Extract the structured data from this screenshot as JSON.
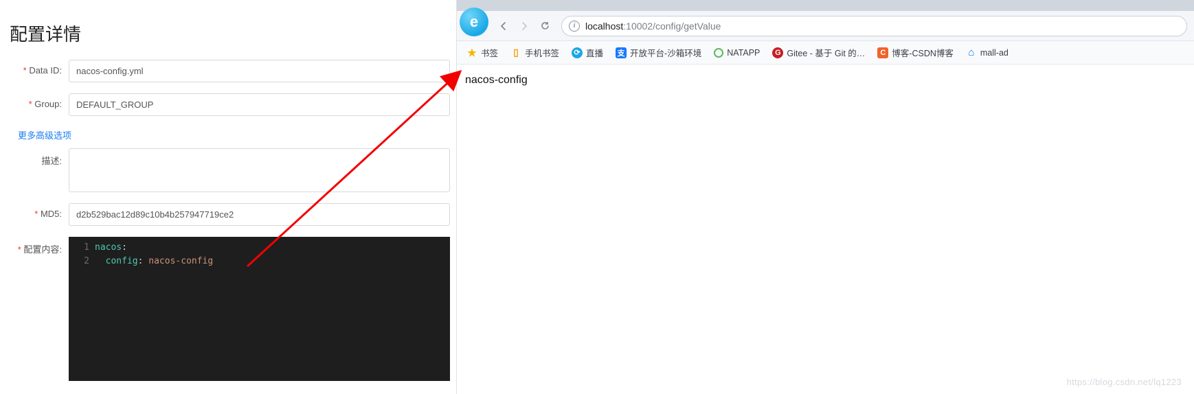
{
  "left": {
    "title": "配置详情",
    "fields": {
      "data_id_label": "Data ID:",
      "data_id_value": "nacos-config.yml",
      "group_label": "Group:",
      "group_value": "DEFAULT_GROUP",
      "adv_link": "更多高级选项",
      "desc_label": "描述:",
      "desc_value": "",
      "md5_label": "MD5:",
      "md5_value": "d2b529bac12d89c10b4b257947719ce2",
      "content_label": "配置内容:"
    },
    "code": {
      "line1_key": "nacos",
      "line1_colon": ":",
      "line2_indent": "  ",
      "line2_key": "config",
      "line2_colon": ": ",
      "line2_val": "nacos-config",
      "gutter1": "1",
      "gutter2": "2"
    }
  },
  "browser": {
    "logo_letter": "e",
    "url_host": "localhost",
    "url_port_path": ":10002/config/getValue",
    "bookmarks": [
      {
        "label": "书签"
      },
      {
        "label": "手机书签"
      },
      {
        "label": "直播"
      },
      {
        "label": "开放平台-沙箱环境"
      },
      {
        "label": "NATAPP"
      },
      {
        "label": "Gitee - 基于 Git 的…"
      },
      {
        "label": "博客-CSDN博客"
      },
      {
        "label": "mall-ad"
      }
    ],
    "page_body": "nacos-config"
  },
  "watermark": "https://blog.csdn.net/lq1223"
}
